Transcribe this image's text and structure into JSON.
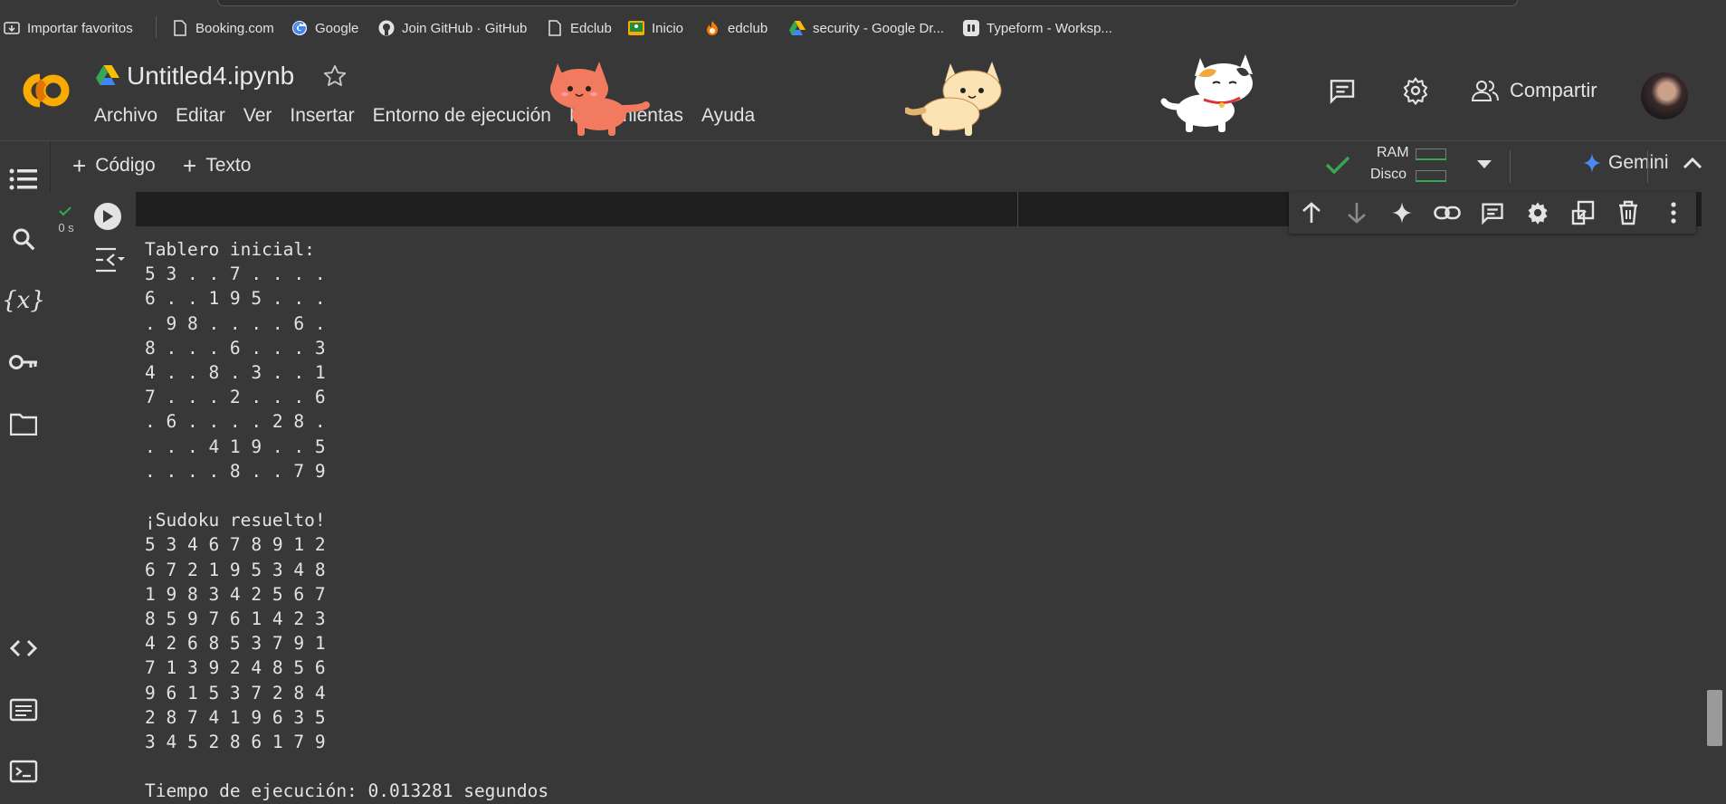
{
  "bookmarks": [
    {
      "label": "Importar favoritos",
      "icon": "import-icon"
    },
    {
      "label": "Booking.com",
      "icon": "page-icon"
    },
    {
      "label": "Google",
      "icon": "google-icon"
    },
    {
      "label": "Join GitHub · GitHub",
      "icon": "github-icon"
    },
    {
      "label": "Edclub",
      "icon": "page-icon"
    },
    {
      "label": "Inicio",
      "icon": "classroom-icon"
    },
    {
      "label": "edclub",
      "icon": "fire-icon"
    },
    {
      "label": "security - Google Dr...",
      "icon": "drive-icon"
    },
    {
      "label": "Typeform - Worksp...",
      "icon": "typeform-icon"
    }
  ],
  "header": {
    "title": "Untitled4.ipynb",
    "menu": [
      "Archivo",
      "Editar",
      "Ver",
      "Insertar",
      "Entorno de ejecución",
      "Herramientas",
      "Ayuda"
    ],
    "share_label": "Compartir"
  },
  "toolbar": {
    "code_label": "Código",
    "text_label": "Texto",
    "ram_label": "RAM",
    "disk_label": "Disco",
    "gemini_label": "Gemini"
  },
  "cell": {
    "exec_time": "0 s",
    "output_lines": [
      "Tablero inicial:",
      "5 3 . . 7 . . . .",
      "6 . . 1 9 5 . . .",
      ". 9 8 . . . . 6 .",
      "8 . . . 6 . . . 3",
      "4 . . 8 . 3 . . 1",
      "7 . . . 2 . . . 6",
      ". 6 . . . . 2 8 .",
      ". . . 4 1 9 . . 5",
      ". . . . 8 . . 7 9",
      "",
      "¡Sudoku resuelto!",
      "5 3 4 6 7 8 9 1 2",
      "6 7 2 1 9 5 3 4 8",
      "1 9 8 3 4 2 5 6 7",
      "8 5 9 7 6 1 4 2 3",
      "4 2 6 8 5 3 7 9 1",
      "7 1 3 9 2 4 8 5 6",
      "9 6 1 5 3 7 2 8 4",
      "2 8 7 4 1 9 6 3 5",
      "3 4 5 2 8 6 1 7 9",
      "",
      "Tiempo de ejecución: 0.013281 segundos"
    ]
  },
  "colors": {
    "background": "#383838",
    "cell_input": "#1e1e1e",
    "accent_green": "#34a853",
    "logo_orange": "#f9ab00"
  }
}
